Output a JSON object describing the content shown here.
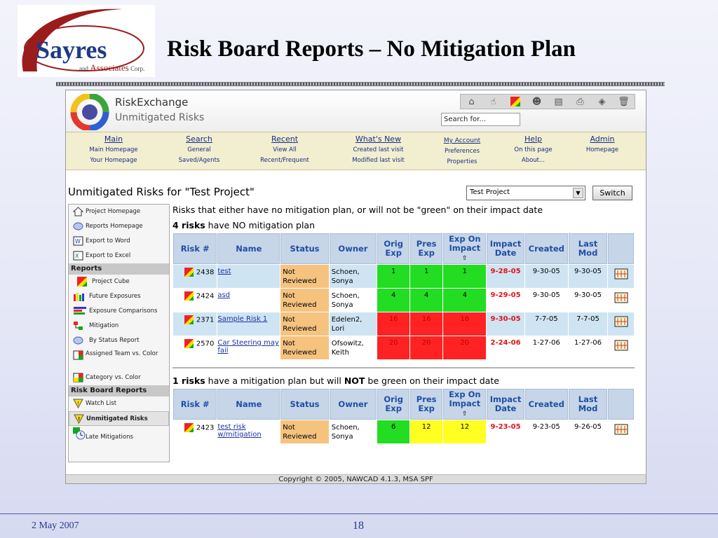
{
  "slide": {
    "logo_name": "Sayres",
    "logo_and": "and",
    "logo_associates": "Associates",
    "logo_corp": "Corp.",
    "title": "Risk Board Reports – No Mitigation Plan",
    "footer_date": "2 May 2007",
    "footer_page": "18"
  },
  "app": {
    "name": "RiskExchange",
    "subtitle": "Unmitigated Risks",
    "search_placeholder": "Search for...",
    "toolbar_icons": [
      "home-icon",
      "cursor-icon",
      "risk-icon",
      "users-icon",
      "document-icon",
      "print-icon",
      "tag-icon",
      "trash-icon"
    ],
    "nav": [
      {
        "head": "Main",
        "subs": [
          "Main Homepage",
          "Your Homepage"
        ]
      },
      {
        "head": "Search",
        "subs": [
          "General",
          "Saved/Agents"
        ]
      },
      {
        "head": "Recent",
        "subs": [
          "View All",
          "Recent/Frequent"
        ]
      },
      {
        "head": "What's New",
        "subs": [
          "Created last visit",
          "Modified last visit"
        ]
      },
      {
        "head": "My Account",
        "subs": [
          "Preferences",
          "Properties"
        ]
      },
      {
        "head": "Help",
        "subs": [
          "On this page",
          "About..."
        ]
      },
      {
        "head": "Admin",
        "subs": [
          "Homepage"
        ]
      }
    ],
    "page_heading": "Unmitigated Risks for \"Test Project\"",
    "project_select": "Test Project",
    "switch_label": "Switch",
    "copyright": "Copyright © 2005, NAWCAD 4.1.3, MSA SPF"
  },
  "sidebar": {
    "top_items": [
      "Project Homepage",
      "Reports Homepage",
      "Export to Word",
      "Export to Excel"
    ],
    "reports_heading": "Reports",
    "report_items": [
      "Project Cube",
      "Future Exposures",
      "Exposure Comparisons",
      "Mitigation",
      "By Status Report",
      "Assigned Team vs. Color",
      "Category vs. Color"
    ],
    "board_heading": "Risk Board Reports",
    "board_items": [
      "Watch List",
      "Unmitigated Risks",
      "Late Mitigations"
    ]
  },
  "content": {
    "description": "Risks that either have no mitigation plan, or will not be \"green\" on their impact date",
    "section1": {
      "count": "4 risks",
      "text": " have NO mitigation plan"
    },
    "section2": {
      "count": "1 risks",
      "text_a": " have a mitigation plan but will ",
      "text_not": "NOT",
      "text_b": " be green on their impact date"
    },
    "columns": [
      "Risk #",
      "Name",
      "Status",
      "Owner",
      "Orig Exp",
      "Pres Exp",
      "Exp On Impact",
      "Impact Date",
      "Created",
      "Last Mod"
    ],
    "rows1": [
      {
        "id": "2438",
        "name": "test",
        "status": "Not Reviewed",
        "owner": "Schoen, Sonya",
        "orig": "1",
        "pres": "1",
        "impact": "1",
        "impact_date": "9-28-05",
        "created": "9-30-05",
        "lastmod": "9-30-05",
        "colors": [
          "g",
          "g",
          "g"
        ]
      },
      {
        "id": "2424",
        "name": "asd",
        "status": "Not Reviewed",
        "owner": "Schoen, Sonya",
        "orig": "4",
        "pres": "4",
        "impact": "4",
        "impact_date": "9-29-05",
        "created": "9-30-05",
        "lastmod": "9-30-05",
        "colors": [
          "g",
          "g",
          "g"
        ]
      },
      {
        "id": "2371",
        "name": "Sample Risk 1",
        "status": "Not Reviewed",
        "owner": "Edelen2, Lori",
        "orig": "16",
        "pres": "16",
        "impact": "16",
        "impact_date": "9-30-05",
        "created": "7-7-05",
        "lastmod": "7-7-05",
        "colors": [
          "r",
          "r",
          "r"
        ]
      },
      {
        "id": "2570",
        "name": "Car Steering may fail",
        "status": "Not Reviewed",
        "owner": "Ofsowitz, Keith",
        "orig": "20",
        "pres": "20",
        "impact": "20",
        "impact_date": "2-24-06",
        "created": "1-27-06",
        "lastmod": "1-27-06",
        "colors": [
          "r",
          "r",
          "r"
        ]
      }
    ],
    "rows2": [
      {
        "id": "2423",
        "name": "test risk w/mitigation",
        "status": "Not Reviewed",
        "owner": "Schoen, Sonya",
        "orig": "6",
        "pres": "12",
        "impact": "12",
        "impact_date": "9-23-05",
        "created": "9-23-05",
        "lastmod": "9-26-05",
        "colors": [
          "g",
          "y",
          "y"
        ]
      }
    ]
  }
}
